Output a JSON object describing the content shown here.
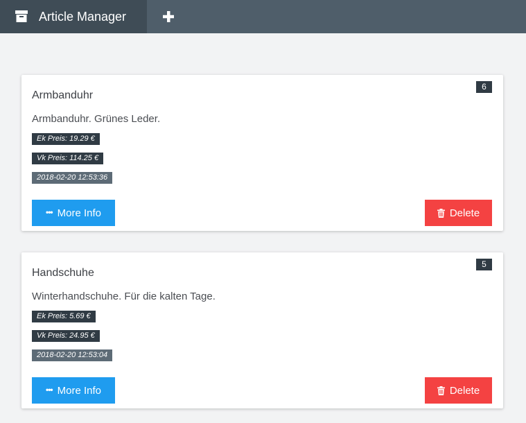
{
  "header": {
    "title": "Article Manager",
    "brand_icon": "archive-box-icon",
    "add_icon": "plus-icon",
    "colors": {
      "bar": "#4f5e6a",
      "brand": "#3f4c56"
    }
  },
  "articles": [
    {
      "id": "6",
      "name": "Armbanduhr",
      "description": "Armbanduhr. Grünes Leder.",
      "ek_price": "Ek Preis: 19.29 €",
      "vk_price": "Vk Preis: 114.25 €",
      "timestamp": "2018-02-20 12:53:36",
      "more_info_label": "More Info",
      "delete_label": "Delete"
    },
    {
      "id": "5",
      "name": "Handschuhe",
      "description": "Winterhandschuhe. Für die kalten Tage.",
      "ek_price": "Ek Preis: 5.69 €",
      "vk_price": "Vk Preis: 24.95 €",
      "timestamp": "2018-02-20 12:53:04",
      "more_info_label": "More Info",
      "delete_label": "Delete"
    }
  ],
  "icons": {
    "more_info": "ellipsis-icon",
    "delete": "trash-icon"
  },
  "colors": {
    "primary": "#1f9cef",
    "danger": "#f44242",
    "dark_tag": "#303b44",
    "date_tag": "#5d6b76",
    "background": "#f2f3f4"
  }
}
